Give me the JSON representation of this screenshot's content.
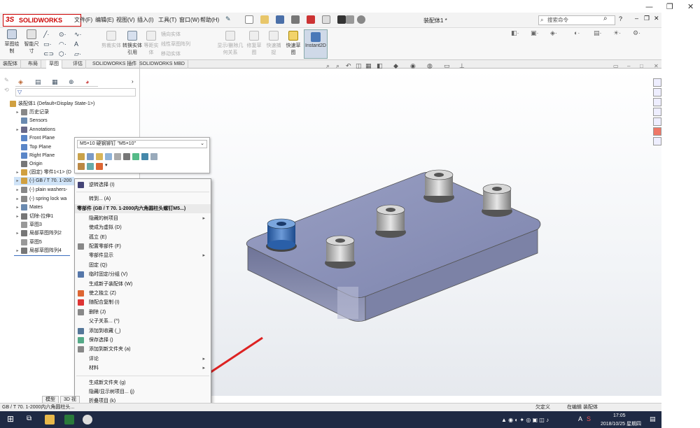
{
  "window": {
    "doc_title": "装配体1 *",
    "search_placeholder": "搜索命令"
  },
  "menus": [
    "文件(F)",
    "编辑(E)",
    "视图(V)",
    "插入(I)",
    "工具(T)",
    "窗口(W)",
    "帮助(H)"
  ],
  "logo_text": "SOLIDWORKS",
  "commands": [
    {
      "label": "草图绘制",
      "enabled": true
    },
    {
      "label": "智能尺寸",
      "enabled": true
    },
    {
      "label": "剪裁实体",
      "enabled": false
    },
    {
      "label": "转换实体引用",
      "enabled": true
    },
    {
      "label": "等距实体",
      "enabled": false
    },
    {
      "label": "镜向实体",
      "enabled": false
    },
    {
      "label": "线性草图阵列",
      "enabled": false
    },
    {
      "label": "移动实体",
      "enabled": false
    },
    {
      "label": "显示/删除几何关系",
      "enabled": false
    },
    {
      "label": "修复草图",
      "enabled": false
    },
    {
      "label": "快速捕捉",
      "enabled": false
    },
    {
      "label": "快速草图",
      "enabled": true
    },
    {
      "label": "Instant2D",
      "enabled": true
    }
  ],
  "tabs": [
    "装配体",
    "布局",
    "草图",
    "评估",
    "SOLIDWORKS 插件",
    "SOLIDWORKS MBD"
  ],
  "active_tab": "草图",
  "tree": [
    {
      "label": "装配体1  (Default<Display State-1>)",
      "arrow": ""
    },
    {
      "label": "历史记录",
      "arrow": "▸"
    },
    {
      "label": "Sensors",
      "arrow": ""
    },
    {
      "label": "Annotations",
      "arrow": "▸"
    },
    {
      "label": "Front Plane",
      "arrow": ""
    },
    {
      "label": "Top Plane",
      "arrow": ""
    },
    {
      "label": "Right Plane",
      "arrow": ""
    },
    {
      "label": "Origin",
      "arrow": ""
    },
    {
      "label": "(固定) 零件1<1> (D",
      "arrow": "▸"
    },
    {
      "label": "(-) GB / T 70.  1-200",
      "arrow": "▸"
    },
    {
      "label": "(-) plain washers-",
      "arrow": "▸"
    },
    {
      "label": "(-) spring lock wa",
      "arrow": "▸"
    },
    {
      "label": "Mates",
      "arrow": "▸"
    },
    {
      "label": "切除-拉伸1",
      "arrow": "▸"
    },
    {
      "label": "草图3",
      "arrow": ""
    },
    {
      "label": "局部草图阵列2",
      "arrow": "▸"
    },
    {
      "label": "草图5",
      "arrow": ""
    },
    {
      "label": "局部草图阵列4",
      "arrow": "▸"
    }
  ],
  "ctx_toolbar": {
    "selector": "M5×10 硬钢铆钉 \"M5×10\""
  },
  "context_menu": [
    {
      "label": "逆转选择 (I)",
      "sub": false,
      "type": "item"
    },
    {
      "type": "sep"
    },
    {
      "label": "转到... (A)",
      "sub": false,
      "type": "item"
    },
    {
      "label": "零部件 (GB / T 70.  1-2000内六角圆柱头螺钉M5...)",
      "sub": false,
      "type": "head"
    },
    {
      "label": "隐藏的树项目",
      "sub": true,
      "type": "item"
    },
    {
      "label": "使成为虚拟 (D)",
      "sub": false,
      "type": "item"
    },
    {
      "label": "孤立 (E)",
      "sub": false,
      "type": "item"
    },
    {
      "label": "配置零部件 (F)",
      "sub": false,
      "type": "item"
    },
    {
      "label": "零部件显示",
      "sub": true,
      "type": "item"
    },
    {
      "label": "固定 (Q)",
      "sub": false,
      "type": "item"
    },
    {
      "label": "临时固定/分组 (V)",
      "sub": false,
      "type": "item"
    },
    {
      "label": "生成新子装配体 (W)",
      "sub": false,
      "type": "item"
    },
    {
      "label": "使之独立 (Z)",
      "sub": false,
      "type": "item"
    },
    {
      "label": "随配合复制 (I)",
      "sub": false,
      "type": "item"
    },
    {
      "label": "删除 (J)",
      "sub": false,
      "type": "item"
    },
    {
      "label": "父子关系... (^)",
      "sub": false,
      "type": "item"
    },
    {
      "label": "添加到收藏 (_)",
      "sub": false,
      "type": "item"
    },
    {
      "label": "保存选择 ()",
      "sub": false,
      "type": "item"
    },
    {
      "label": "添加到新文件夹 (a)",
      "sub": false,
      "type": "item"
    },
    {
      "label": "评论",
      "sub": true,
      "type": "item"
    },
    {
      "label": "材料",
      "sub": true,
      "type": "item"
    },
    {
      "type": "sep"
    },
    {
      "label": "生成新文件夹 (g)",
      "sub": false,
      "type": "item"
    },
    {
      "label": "隐藏/显示树项目... (j)",
      "sub": false,
      "type": "item"
    },
    {
      "label": "折叠项目 (k)",
      "sub": false,
      "type": "item"
    },
    {
      "type": "sep"
    },
    {
      "label": "»",
      "sub": false,
      "type": "more"
    }
  ],
  "bottom_tabs": [
    "模型",
    "3D 视"
  ],
  "status": {
    "left": "GB / T 70.  1-2000内六角圆柱头...",
    "right_partial": "欠定义",
    "right_partial2": "在编辑 装配体"
  },
  "taskbar": {
    "time": "17:05",
    "date": "2018/10/25 星期四",
    "ime": "A"
  },
  "colors": {
    "accent_red": "#c0241f",
    "selection": "#cfe3f7",
    "plate": "#8c93b8",
    "blue_bolt": "#2a5fa8"
  }
}
